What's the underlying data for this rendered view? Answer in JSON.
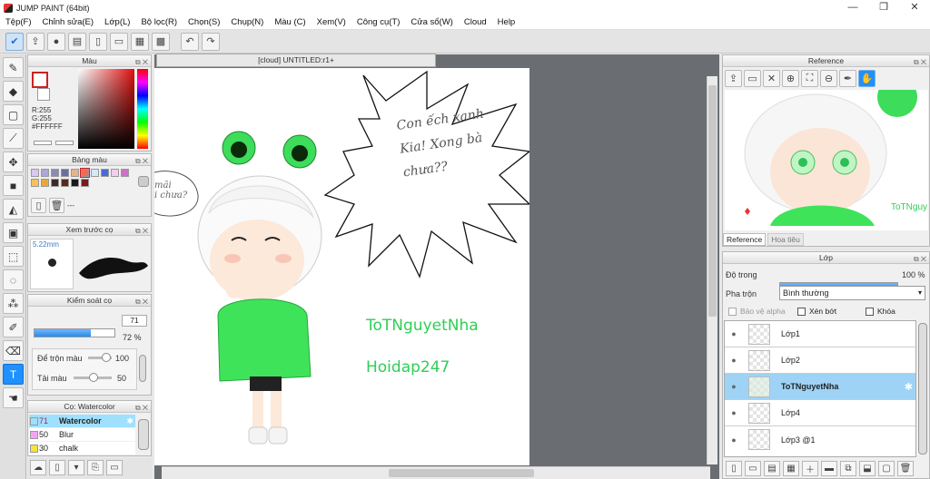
{
  "app": {
    "title": "JUMP PAINT (64bit)"
  },
  "window_controls": {
    "minimize": "—",
    "maximize": "❐",
    "close": "✕"
  },
  "menu": [
    "Tệp(F)",
    "Chỉnh sửa(E)",
    "Lớp(L)",
    "Bộ lọc(R)",
    "Chọn(S)",
    "Chụp(N)",
    "Màu (C)",
    "Xem(V)",
    "Công cụ(T)",
    "Cửa sổ(W)",
    "Cloud",
    "Help"
  ],
  "document": {
    "tab_title": "[cloud] UNTITLED:r1+"
  },
  "color_panel": {
    "title": "Màu",
    "r": "R:255",
    "g": "G:255",
    "hex": "#FFFFFF"
  },
  "palette_panel": {
    "title": "Bảng màu",
    "more": "---",
    "swatches": [
      "#d9c8f0",
      "#b0a4d8",
      "#8a8ab8",
      "#6b6fa0",
      "#e8b38a",
      "#f06a5a",
      "#d4e8f8",
      "#4a6ad8",
      "#f0d0e8",
      "#d070c8",
      "#f8c060",
      "#e8a838",
      "#3a2a2a",
      "#5a2a1a",
      "#1a1a1a",
      "#7a1a1a"
    ]
  },
  "brush_preview": {
    "title": "Xem trước cọ",
    "size": "5.22mm"
  },
  "brush_control": {
    "title": "Kiểm soát cọ",
    "size_value": "71",
    "opacity_value": "72 %",
    "size_fill": 0.71,
    "opacity_fill": 0.72,
    "mix_label": "Để trộn màu",
    "mix_value": "100",
    "refill_label": "Tải màu",
    "refill_value": "50"
  },
  "brush_list": {
    "title": "Cọ: Watercolor",
    "items": [
      {
        "size": "71",
        "name": "Watercolor",
        "color": "#9fe0ff"
      },
      {
        "size": "50",
        "name": "Blur",
        "color": "#f2a5f0"
      },
      {
        "size": "30",
        "name": "chalk",
        "color": "#f5e23a"
      }
    ]
  },
  "canvas_text": {
    "username": "ToTNguyetNha",
    "site": "Hoidap247",
    "bubble_text": "Con ếch xanh\nKia! Xong bà\nchưa??",
    "side_text": "mãi\ni chưa?"
  },
  "reference_panel": {
    "title": "Reference",
    "tab1": "Reference",
    "tab2": "Hoa tiêu",
    "ref_watermark": "ToTNguy"
  },
  "layer_panel": {
    "title": "Lớp",
    "opacity_label": "Độ trong",
    "opacity_value": "100 %",
    "opacity_fill": 1.0,
    "blend_label": "Pha trộn",
    "blend_value": "Bình thường",
    "protect_alpha": "Bảo vệ alpha",
    "clip": "Xén bớt",
    "lock": "Khóa",
    "layers": [
      {
        "name": "Lớp1",
        "selected": false
      },
      {
        "name": "Lớp2",
        "selected": false
      },
      {
        "name": "ToTNguyetNha",
        "selected": true
      },
      {
        "name": "Lớp4",
        "selected": false
      },
      {
        "name": "Lớp3 @1",
        "selected": false
      }
    ]
  }
}
